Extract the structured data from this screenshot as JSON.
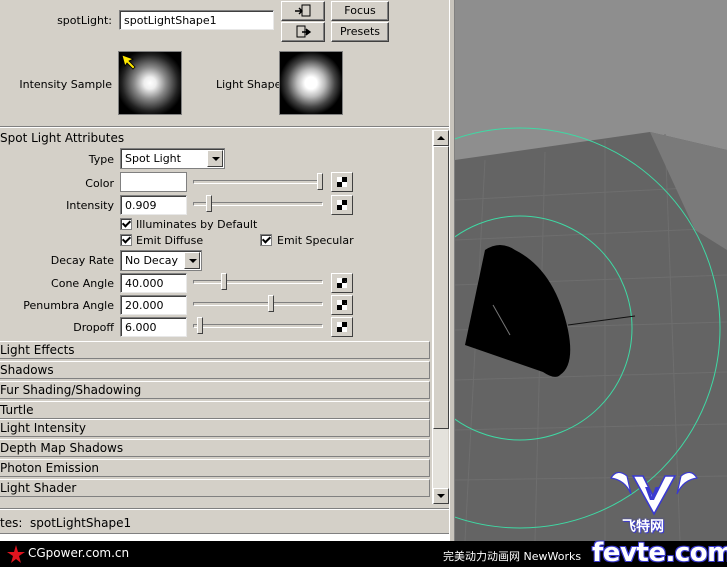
{
  "header": {
    "node_label": "spotLight:",
    "node_value": "spotLightShape1",
    "focus_label": "Focus",
    "presets_label": "Presets",
    "intensity_sample_label": "Intensity Sample",
    "light_shape_label": "Light Shape"
  },
  "spot": {
    "section_title": "Spot Light Attributes",
    "type_label": "Type",
    "type_value": "Spot Light",
    "color_label": "Color",
    "color_value": "#ffffff",
    "intensity_label": "Intensity",
    "intensity_value": "0.909",
    "illum_label": "Illuminates by Default",
    "emit_diffuse_label": "Emit Diffuse",
    "emit_specular_label": "Emit Specular",
    "decay_label": "Decay Rate",
    "decay_value": "No Decay",
    "cone_label": "Cone Angle",
    "cone_value": "40.000",
    "penumbra_label": "Penumbra Angle",
    "penumbra_value": "20.000",
    "dropoff_label": "Dropoff",
    "dropoff_value": "6.000"
  },
  "sliders": {
    "color_fraction": 0.98,
    "intensity_fraction": 0.12,
    "cone_fraction": 0.24,
    "penumbra_fraction": 0.6,
    "dropoff_fraction": 0.05
  },
  "sections": [
    "Light Effects",
    "Shadows",
    "Fur Shading/Shadowing",
    "Turtle",
    "Light Intensity",
    "Depth Map Shadows",
    "Photon Emission",
    "Light Shader"
  ],
  "status": {
    "text": "tes:  spotLightShape1"
  },
  "footer": {
    "left_text": "CGpower.com.cn",
    "mid_text": "完美动力动画网 NewWorks",
    "logo_text": "fevte.com",
    "logo_sub": "飞特网",
    "logo_letter": "V"
  },
  "colors": {
    "panel_bg": "#d4d0c8",
    "viewport_bg": "#8e8e8e",
    "circle_color": "#3fd9a4",
    "logo_blue": "#3a3ad0"
  },
  "icons": {
    "select_icon": "select-node-icon",
    "load_icon": "load-attributes-icon",
    "map_icon": "map-texture-icon"
  }
}
